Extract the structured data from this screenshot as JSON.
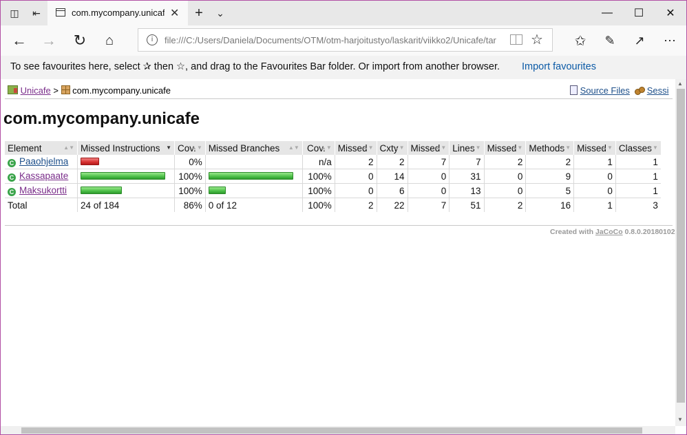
{
  "browser": {
    "tab_title": "com.mycompany.unicaf",
    "address": "file:///C:/Users/Daniela/Documents/OTM/otm-harjoitustyo/laskarit/viikko2/Unicafe/tar",
    "favourites_message": "To see favourites here, select ✰ then ☆, and drag to the Favourites Bar folder. Or import from another browser.",
    "import_link": "Import favourites"
  },
  "breadcrumb": {
    "root": "Unicafe",
    "separator": ">",
    "current": "com.mycompany.unicafe",
    "source_files": "Source Files",
    "sessions": "Sessi"
  },
  "page_title": "com.mycompany.unicafe",
  "table": {
    "headers": [
      "Element",
      "Missed Instructions",
      "Cov.",
      "Missed Branches",
      "Cov.",
      "Missed",
      "Cxty",
      "Missed",
      "Lines",
      "Missed",
      "Methods",
      "Missed",
      "Classes"
    ],
    "rows": [
      {
        "name": "Paaohjelma",
        "instr_cov": "0%",
        "branch_cov": "n/a",
        "cxty_missed": "2",
        "cxty": "2",
        "lines_missed": "7",
        "lines": "7",
        "methods_missed": "2",
        "methods": "2",
        "classes_missed": "1",
        "classes": "1",
        "instr_missed_fraction": 1.0,
        "instr_bar_color": "red",
        "branch_bar_color": null
      },
      {
        "name": "Kassapaate",
        "instr_cov": "100%",
        "branch_cov": "100%",
        "cxty_missed": "0",
        "cxty": "14",
        "lines_missed": "0",
        "lines": "31",
        "methods_missed": "0",
        "methods": "9",
        "classes_missed": "0",
        "classes": "1",
        "instr_missed_fraction": 0.0,
        "instr_bar_color": "green",
        "branch_bar_color": "green"
      },
      {
        "name": "Maksukortti",
        "instr_cov": "100%",
        "branch_cov": "100%",
        "cxty_missed": "0",
        "cxty": "6",
        "lines_missed": "0",
        "lines": "13",
        "methods_missed": "0",
        "methods": "5",
        "classes_missed": "0",
        "classes": "1",
        "instr_missed_fraction": 0.0,
        "instr_bar_color": "green",
        "branch_bar_color": "green"
      }
    ],
    "total": {
      "label": "Total",
      "instr": "24 of 184",
      "instr_cov": "86%",
      "branch": "0 of 12",
      "branch_cov": "100%",
      "cxty_missed": "2",
      "cxty": "22",
      "lines_missed": "7",
      "lines": "51",
      "methods_missed": "2",
      "methods": "16",
      "classes_missed": "1",
      "classes": "3"
    }
  },
  "footer": {
    "created_with": "Created with",
    "tool": "JaCoCo",
    "version": "0.8.0.20180102"
  },
  "colors": {
    "covered": "#4cbf48",
    "missed": "#d83030",
    "link": "#1d4f8a",
    "visited_link": "#7a2d8a"
  }
}
